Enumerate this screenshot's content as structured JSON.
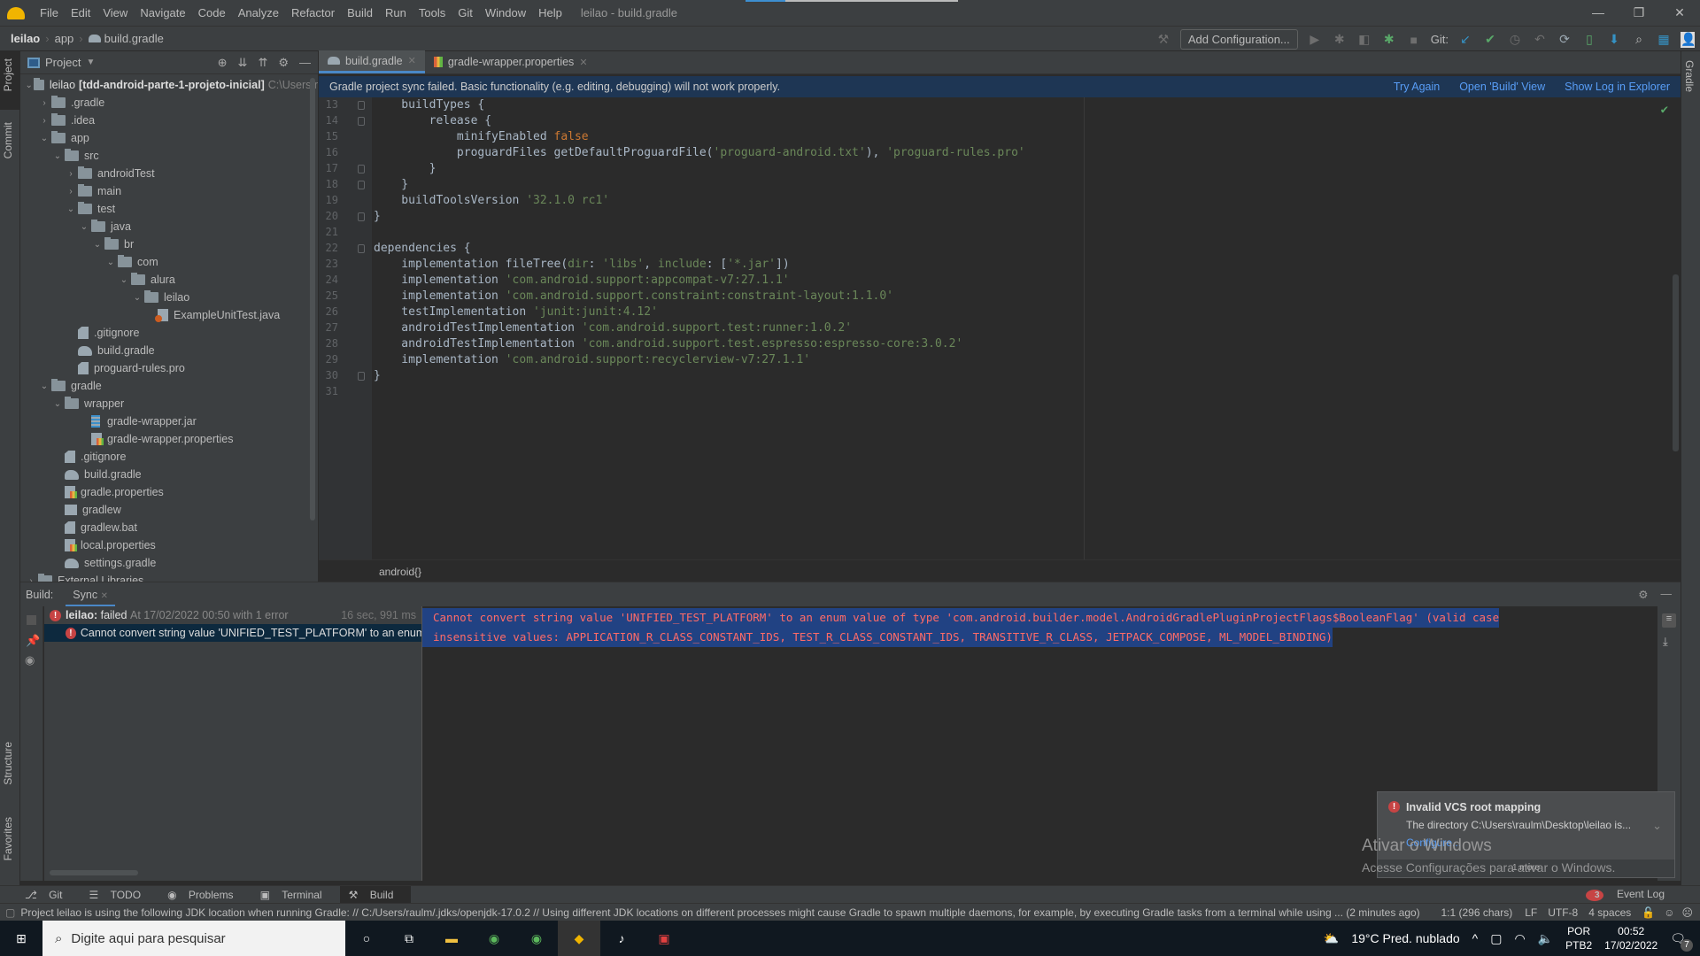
{
  "window": {
    "title": "leilao - build.gradle",
    "menu": [
      "File",
      "Edit",
      "View",
      "Navigate",
      "Code",
      "Analyze",
      "Refactor",
      "Build",
      "Run",
      "Tools",
      "Git",
      "Window",
      "Help"
    ],
    "controls": {
      "minimize": "—",
      "restore": "❐",
      "close": "✕"
    }
  },
  "navbar": {
    "breadcrumb": [
      "leilao",
      "app",
      "build.gradle"
    ],
    "add_configuration": "Add Configuration...",
    "git_label": "Git:"
  },
  "sidebar_left": {
    "tabs": [
      "Project",
      "Commit",
      "Structure",
      "Favorites"
    ]
  },
  "sidebar_right": {
    "tabs": [
      "Gradle"
    ]
  },
  "project": {
    "header": "Project",
    "tree": [
      {
        "label": "leilao",
        "extra": "[tdd-android-parte-1-projeto-inicial]",
        "path": "C:\\Users\\r",
        "depth": 0,
        "type": "module",
        "expanded": true
      },
      {
        "label": ".gradle",
        "depth": 1,
        "type": "folder",
        "expanded": false
      },
      {
        "label": ".idea",
        "depth": 1,
        "type": "folder",
        "expanded": false
      },
      {
        "label": "app",
        "depth": 1,
        "type": "folder",
        "expanded": true
      },
      {
        "label": "src",
        "depth": 2,
        "type": "folder",
        "expanded": true
      },
      {
        "label": "androidTest",
        "depth": 3,
        "type": "folder",
        "expanded": false
      },
      {
        "label": "main",
        "depth": 3,
        "type": "folder",
        "expanded": false
      },
      {
        "label": "test",
        "depth": 3,
        "type": "folder",
        "expanded": true
      },
      {
        "label": "java",
        "depth": 4,
        "type": "folder",
        "expanded": true
      },
      {
        "label": "br",
        "depth": 5,
        "type": "folder",
        "expanded": true
      },
      {
        "label": "com",
        "depth": 6,
        "type": "folder",
        "expanded": true
      },
      {
        "label": "alura",
        "depth": 7,
        "type": "folder",
        "expanded": true
      },
      {
        "label": "leilao",
        "depth": 8,
        "type": "folder",
        "expanded": true
      },
      {
        "label": "ExampleUnitTest.java",
        "depth": 9,
        "type": "java"
      },
      {
        "label": ".gitignore",
        "depth": 3,
        "type": "file"
      },
      {
        "label": "build.gradle",
        "depth": 3,
        "type": "gradle"
      },
      {
        "label": "proguard-rules.pro",
        "depth": 3,
        "type": "file"
      },
      {
        "label": "gradle",
        "depth": 1,
        "type": "folder",
        "expanded": true
      },
      {
        "label": "wrapper",
        "depth": 2,
        "type": "folder",
        "expanded": true
      },
      {
        "label": "gradle-wrapper.jar",
        "depth": 4,
        "type": "jar"
      },
      {
        "label": "gradle-wrapper.properties",
        "depth": 4,
        "type": "properties"
      },
      {
        "label": ".gitignore",
        "depth": 2,
        "type": "file"
      },
      {
        "label": "build.gradle",
        "depth": 2,
        "type": "gradle"
      },
      {
        "label": "gradle.properties",
        "depth": 2,
        "type": "properties"
      },
      {
        "label": "gradlew",
        "depth": 2,
        "type": "shell"
      },
      {
        "label": "gradlew.bat",
        "depth": 2,
        "type": "file"
      },
      {
        "label": "local.properties",
        "depth": 2,
        "type": "properties"
      },
      {
        "label": "settings.gradle",
        "depth": 2,
        "type": "gradle"
      },
      {
        "label": "External Libraries",
        "depth": 0,
        "type": "folder",
        "expanded": false
      }
    ]
  },
  "tabs": [
    {
      "label": "build.gradle",
      "active": true
    },
    {
      "label": "gradle-wrapper.properties",
      "active": false
    }
  ],
  "banner": {
    "message": "Gradle project sync failed. Basic functionality (e.g. editing, debugging) will not work properly.",
    "links": [
      "Try Again",
      "Open 'Build' View",
      "Show Log in Explorer"
    ]
  },
  "editor": {
    "lines": [
      {
        "n": "13",
        "tokens": [
          [
            "pn",
            "    buildTypes {"
          ]
        ]
      },
      {
        "n": "14",
        "tokens": [
          [
            "pn",
            "        release {"
          ]
        ]
      },
      {
        "n": "15",
        "tokens": [
          [
            "pn",
            "            minifyEnabled "
          ],
          [
            "kw",
            "false"
          ]
        ]
      },
      {
        "n": "16",
        "tokens": [
          [
            "pn",
            "            proguardFiles getDefaultProguardFile("
          ],
          [
            "st",
            "'proguard-android.txt'"
          ],
          [
            "pn",
            "), "
          ],
          [
            "st",
            "'proguard-rules.pro'"
          ]
        ]
      },
      {
        "n": "17",
        "tokens": [
          [
            "pn",
            "        }"
          ]
        ]
      },
      {
        "n": "18",
        "tokens": [
          [
            "pn",
            "    }"
          ]
        ]
      },
      {
        "n": "19",
        "tokens": [
          [
            "pn",
            "    buildToolsVersion "
          ],
          [
            "st",
            "'32.1.0 rc1'"
          ]
        ]
      },
      {
        "n": "20",
        "tokens": [
          [
            "pn",
            "}"
          ]
        ]
      },
      {
        "n": "21",
        "tokens": []
      },
      {
        "n": "22",
        "tokens": [
          [
            "pn",
            "dependencies {"
          ]
        ]
      },
      {
        "n": "23",
        "tokens": [
          [
            "pn",
            "    implementation fileTree("
          ],
          [
            "st",
            "dir"
          ],
          [
            "pn",
            ": "
          ],
          [
            "st",
            "'libs'"
          ],
          [
            "pn",
            ", "
          ],
          [
            "st",
            "include"
          ],
          [
            "pn",
            ": ["
          ],
          [
            "st",
            "'*.jar'"
          ],
          [
            "pn",
            "])"
          ]
        ]
      },
      {
        "n": "24",
        "tokens": [
          [
            "pn",
            "    implementation "
          ],
          [
            "st",
            "'com.android.support:appcompat-v7:27.1.1'"
          ]
        ]
      },
      {
        "n": "25",
        "tokens": [
          [
            "pn",
            "    implementation "
          ],
          [
            "st",
            "'com.android.support.constraint:constraint-layout:1.1.0'"
          ]
        ]
      },
      {
        "n": "26",
        "tokens": [
          [
            "pn",
            "    testImplementation "
          ],
          [
            "st",
            "'junit:junit:4.12'"
          ]
        ]
      },
      {
        "n": "27",
        "tokens": [
          [
            "pn",
            "    androidTestImplementation "
          ],
          [
            "st",
            "'com.android.support.test:runner:1.0.2'"
          ]
        ]
      },
      {
        "n": "28",
        "tokens": [
          [
            "pn",
            "    androidTestImplementation "
          ],
          [
            "st",
            "'com.android.support.test.espresso:espresso-core:3.0.2'"
          ]
        ]
      },
      {
        "n": "29",
        "tokens": [
          [
            "pn",
            "    implementation "
          ],
          [
            "st",
            "'com.android.support:recyclerview-v7:27.1.1'"
          ]
        ]
      },
      {
        "n": "30",
        "tokens": [
          [
            "pn",
            "}"
          ]
        ]
      },
      {
        "n": "31",
        "tokens": []
      }
    ],
    "breadcrumb": "android{}"
  },
  "build": {
    "label": "Build:",
    "tab": "Sync",
    "tree": {
      "root_name": "leilao:",
      "root_status": "failed",
      "root_detail": "At 17/02/2022 00:50 with 1 error",
      "duration": "16 sec, 991 ms",
      "error": "Cannot convert string value 'UNIFIED_TEST_PLATFORM' to an enum value"
    },
    "output": [
      "Cannot convert string value 'UNIFIED_TEST_PLATFORM' to an enum value of type 'com.android.builder.model.AndroidGradlePluginProjectFlags$BooleanFlag' (valid case",
      "insensitive values: APPLICATION_R_CLASS_CONSTANT_IDS, TEST_R_CLASS_CONSTANT_IDS, TRANSITIVE_R_CLASS, JETPACK_COMPOSE, ML_MODEL_BINDING)"
    ]
  },
  "notification": {
    "title": "Invalid VCS root mapping",
    "detail": "The directory C:\\Users\\raulm\\Desktop\\leilao is...",
    "action": "Configure...",
    "footer": "1 more"
  },
  "watermark": {
    "title": "Ativar o Windows",
    "subtitle": "Acesse Configurações para ativar o Windows."
  },
  "toolstrip": {
    "items": [
      "Git",
      "TODO",
      "Problems",
      "Terminal",
      "Build"
    ],
    "event_log": "Event Log",
    "event_count": "3"
  },
  "statusbar": {
    "message": "Project leilao is using the following JDK location when running Gradle: // C:/Users/raulm/.jdks/openjdk-17.0.2 // Using different JDK locations on different processes might cause Gradle to spawn multiple daemons, for example, by executing Gradle tasks from a terminal while using ... (2 minutes ago)",
    "position": "1:1 (296 chars)",
    "line_sep": "LF",
    "encoding": "UTF-8",
    "indent": "4 spaces"
  },
  "taskbar": {
    "search_placeholder": "Digite aqui para pesquisar",
    "weather": "19°C  Pred. nublado",
    "lang1": "POR",
    "lang2": "PTB2",
    "time": "00:52",
    "date": "17/02/2022",
    "notif_count": "7"
  }
}
